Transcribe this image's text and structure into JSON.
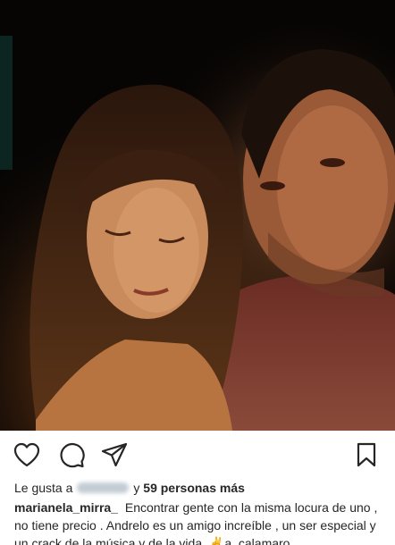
{
  "post": {
    "photo": {
      "alt": "photo-of-two-people-in-dim-light"
    },
    "actions": {
      "like_icon": "heart-outline-icon",
      "comment_icon": "comment-bubble-icon",
      "share_icon": "paper-plane-icon",
      "save_icon": "bookmark-icon"
    },
    "likes": {
      "prefix": "Le gusta a",
      "connector": "y",
      "count_text": "59 personas más"
    },
    "caption": {
      "username": "marianela_mirra_",
      "text": "Encontrar gente con la misma locura de uno , no tiene precio . Andrelo es un amigo increíble , un ser especial y un crack de la música y de la vida. ✌a_calamaro"
    }
  }
}
